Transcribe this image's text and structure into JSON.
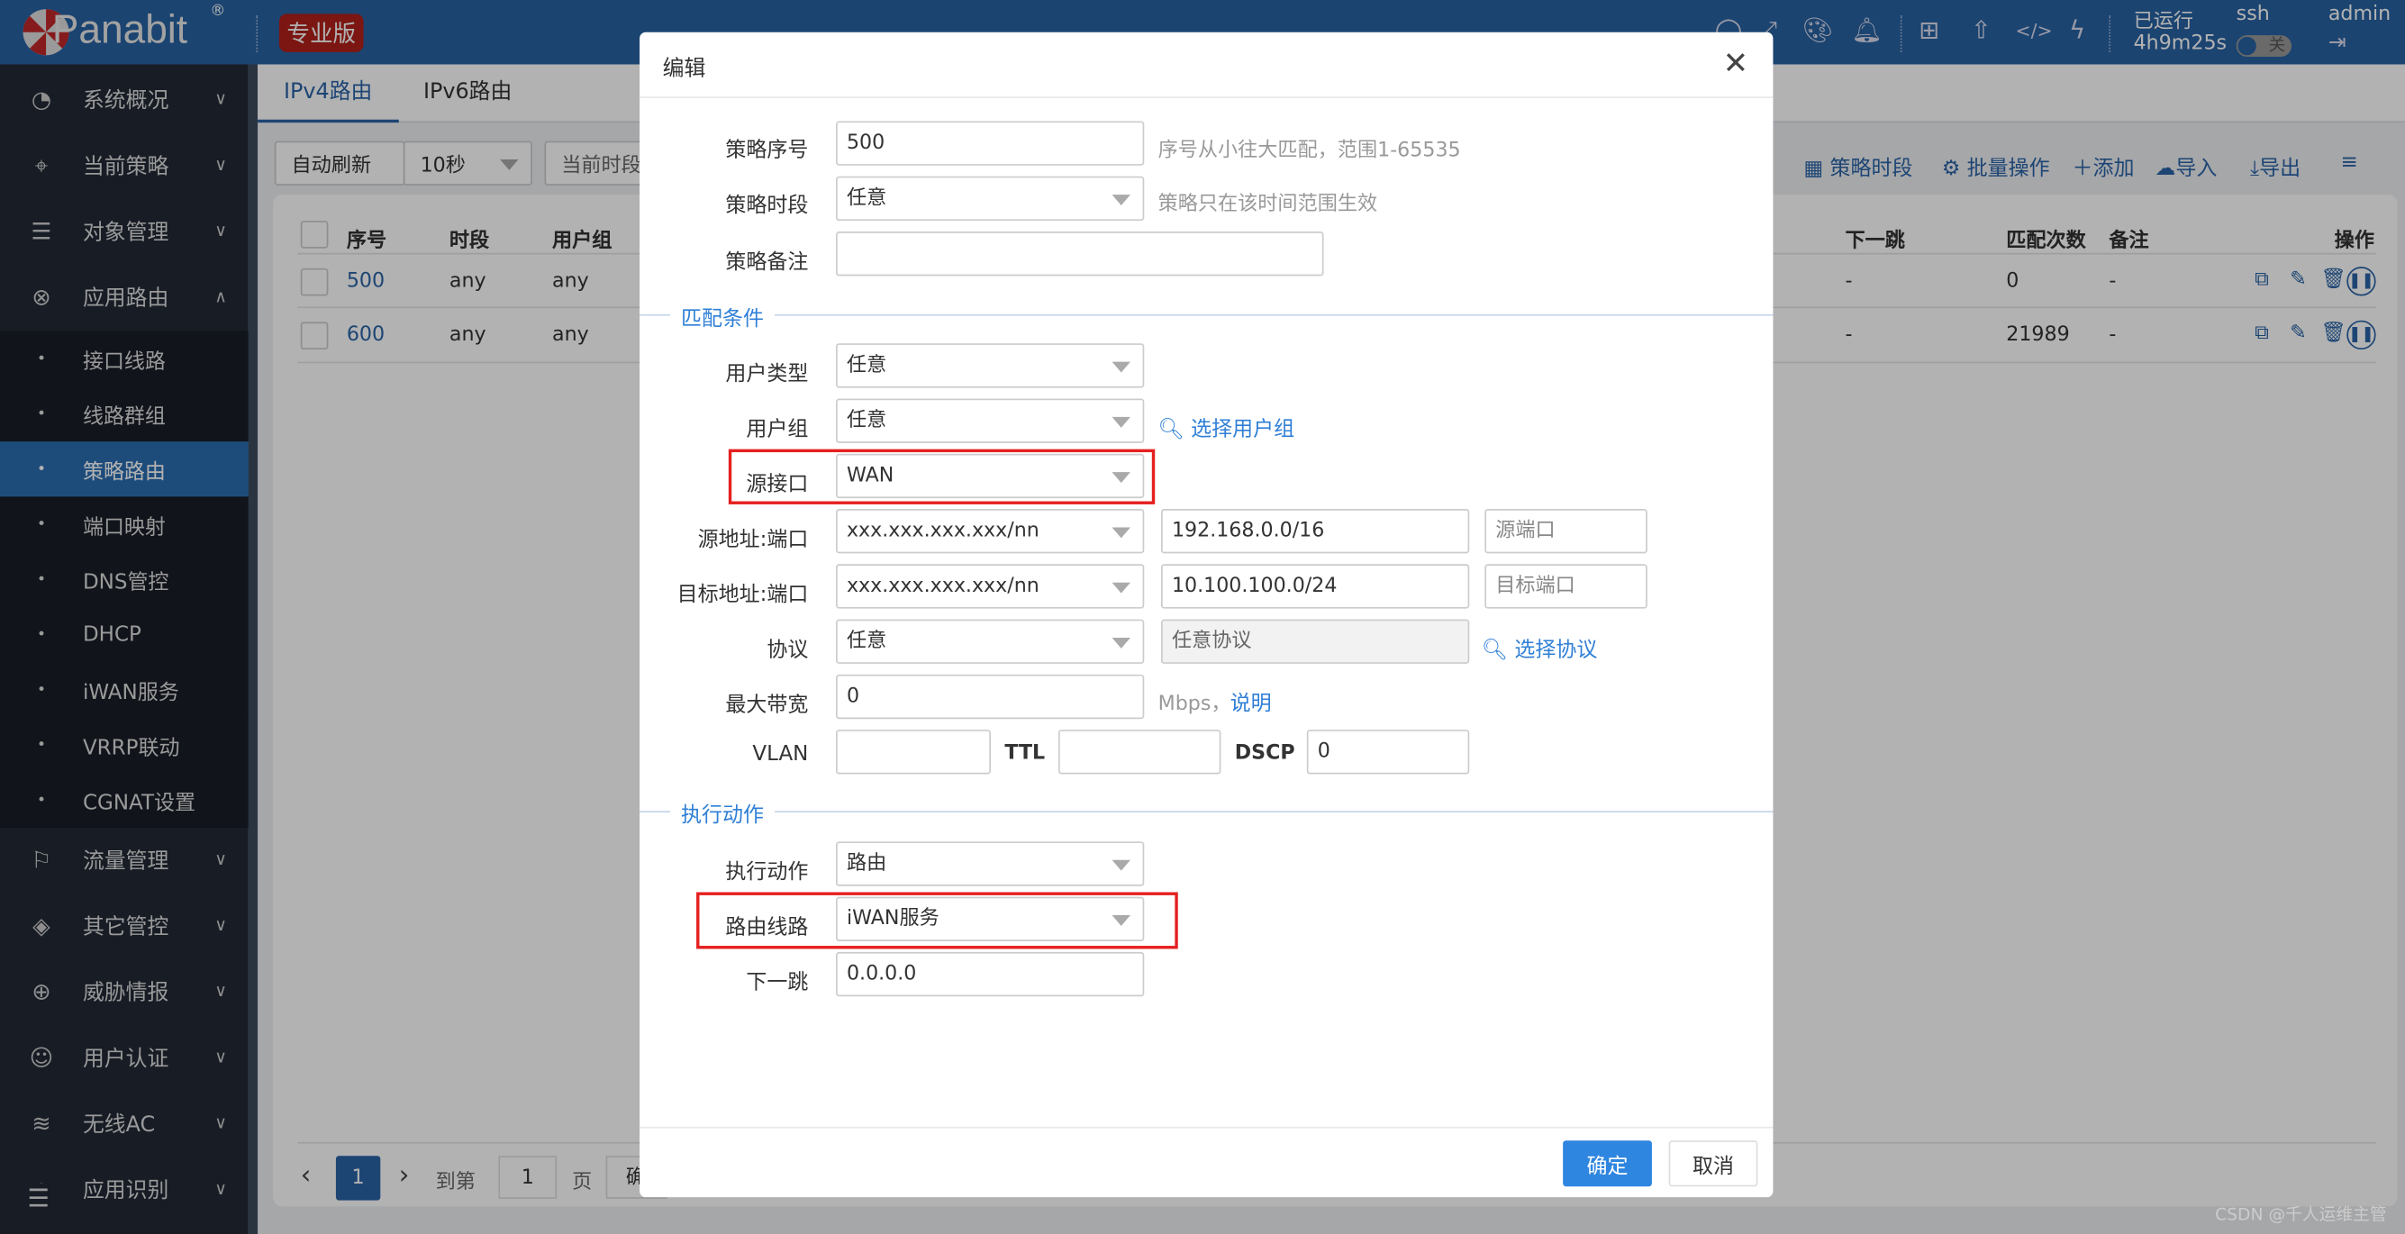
{
  "header": {
    "logo": "Panabit",
    "logo_reg": "®",
    "edition": "专业版",
    "uptime_label": "已运行",
    "uptime": "4h9m25s",
    "ssh_label": "ssh",
    "ssh_toggle": "关",
    "user": "admin",
    "icons": [
      "search-icon",
      "fullscreen-icon",
      "palette-icon",
      "bell-icon",
      "add-widget-icon",
      "upload-icon",
      "code-icon",
      "lightning-icon",
      "logout-icon"
    ],
    "color": "#2862a3"
  },
  "sidebar": {
    "items": [
      {
        "label": "系统概况",
        "icon": "dashboard-icon"
      },
      {
        "label": "当前策略",
        "icon": "location-icon"
      },
      {
        "label": "对象管理",
        "icon": "database-icon"
      },
      {
        "label": "应用路由",
        "icon": "route-icon",
        "expanded": true
      },
      {
        "label": "流量管理",
        "icon": "flag-icon"
      },
      {
        "label": "其它管控",
        "icon": "layers-icon"
      },
      {
        "label": "威胁情报",
        "icon": "target-icon"
      },
      {
        "label": "用户认证",
        "icon": "user-icon"
      },
      {
        "label": "无线AC",
        "icon": "wifi-icon"
      },
      {
        "label": "应用识别",
        "icon": "apps-icon"
      }
    ],
    "subitems": [
      "接口线路",
      "线路群组",
      "策略路由",
      "端口映射",
      "DNS管控",
      "DHCP",
      "iWAN服务",
      "VRRP联动",
      "CGNAT设置"
    ],
    "active_sub": "策略路由",
    "active_color": "#2a6db0"
  },
  "tabs": [
    "IPv4路由",
    "IPv6路由"
  ],
  "toolbar": {
    "auto_refresh": "自动刷新",
    "interval": "10秒",
    "period": "当前时段",
    "policy_period": "策略时段",
    "batch": "批量操作",
    "add": "添加",
    "import": "导入",
    "export": "导出"
  },
  "table": {
    "headers": [
      "序号",
      "时段",
      "用户组",
      "下一跳",
      "匹配次数",
      "备注",
      "操作"
    ],
    "rows": [
      {
        "id": "500",
        "period": "any",
        "group": "any",
        "nexthop": "-",
        "matches": "0",
        "note": "-"
      },
      {
        "id": "600",
        "period": "any",
        "group": "any",
        "nexthop": "-",
        "matches": "21989",
        "note": "-"
      }
    ]
  },
  "pagination": {
    "current": "1",
    "goto_label": "到第",
    "goto_value": "1",
    "page_label": "页",
    "confirm": "确"
  },
  "dialog": {
    "title": "编辑",
    "policy_no": {
      "label": "策略序号",
      "value": "500",
      "hint": "序号从小往大匹配，范围1-65535"
    },
    "policy_period": {
      "label": "策略时段",
      "value": "任意",
      "hint": "策略只在该时间范围生效"
    },
    "policy_note": {
      "label": "策略备注",
      "value": ""
    },
    "section_match": "匹配条件",
    "user_type": {
      "label": "用户类型",
      "value": "任意"
    },
    "user_group": {
      "label": "用户组",
      "value": "任意",
      "link": "选择用户组"
    },
    "src_if": {
      "label": "源接口",
      "value": "WAN"
    },
    "src_addr": {
      "label": "源地址:端口",
      "type": "xxx.xxx.xxx.xxx/nn",
      "value": "192.168.0.0/16",
      "port_placeholder": "源端口"
    },
    "dst_addr": {
      "label": "目标地址:端口",
      "type": "xxx.xxx.xxx.xxx/nn",
      "value": "10.100.100.0/24",
      "port_placeholder": "目标端口"
    },
    "protocol": {
      "label": "协议",
      "value": "任意",
      "field": "任意协议",
      "link": "选择协议"
    },
    "bandwidth": {
      "label": "最大带宽",
      "value": "0",
      "unit": "Mbps，",
      "link": "说明"
    },
    "vlan": {
      "label": "VLAN",
      "value": ""
    },
    "ttl": {
      "label": "TTL",
      "value": ""
    },
    "dscp": {
      "label": "DSCP",
      "value": "0"
    },
    "section_action": "执行动作",
    "action": {
      "label": "执行动作",
      "value": "路由"
    },
    "route_line": {
      "label": "路由线路",
      "value": "iWAN服务"
    },
    "nexthop": {
      "label": "下一跳",
      "value": "0.0.0.0"
    },
    "ok": "确定",
    "cancel": "取消",
    "ok_color": "#2f86e0"
  },
  "watermark": "CSDN @千人运维主管"
}
